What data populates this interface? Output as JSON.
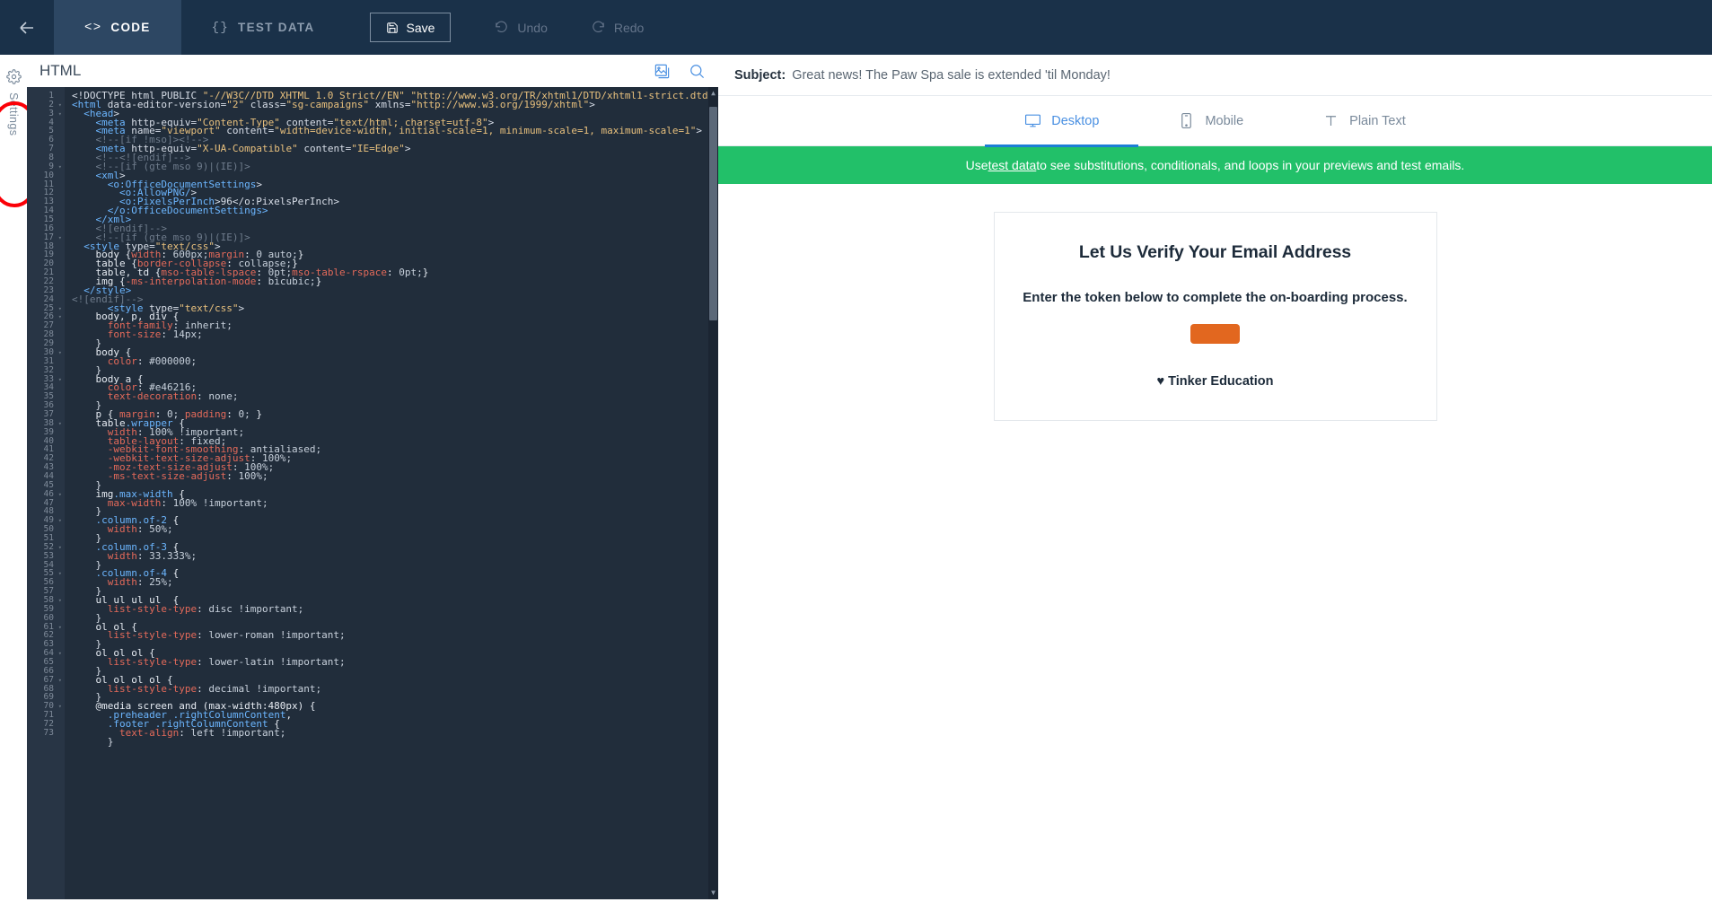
{
  "topbar": {
    "back_icon": "back-arrow-icon",
    "tabs": [
      {
        "id": "code",
        "glyph": "<>",
        "label": "CODE",
        "active": true
      },
      {
        "id": "test-data",
        "glyph": "{}",
        "label": "TEST DATA",
        "active": false
      }
    ],
    "save_label": "Save",
    "save_icon": "floppy-disk-icon",
    "undo_label": "Undo",
    "undo_icon": "undo-arrow-icon",
    "redo_label": "Redo",
    "redo_icon": "redo-arrow-icon"
  },
  "sidebar": {
    "settings_label": "Settings",
    "settings_icon": "gear-icon",
    "highlight_color": "#fb0007"
  },
  "editor": {
    "title": "HTML",
    "image_icon": "insert-image-icon",
    "search_icon": "search-icon",
    "first_line": 1,
    "last_line": 73,
    "fold_lines": [
      2,
      3,
      9,
      17,
      25,
      26,
      30,
      33,
      38,
      46,
      49,
      52,
      55,
      58,
      61,
      64,
      67,
      70
    ],
    "lines": [
      "<!DOCTYPE html PUBLIC \"-//W3C//DTD XHTML 1.0 Strict//EN\" \"http://www.w3.org/TR/xhtml1/DTD/xhtml1-strict.dtd\" >",
      "<html data-editor-version=\"2\" class=\"sg-campaigns\" xmlns=\"http://www.w3.org/1999/xhtml\">",
      "  <head>",
      "    <meta http-equiv=\"Content-Type\" content=\"text/html; charset=utf-8\">",
      "    <meta name=\"viewport\" content=\"width=device-width, initial-scale=1, minimum-scale=1, maximum-scale=1\">",
      "    <!--[if !mso]><!-->",
      "    <meta http-equiv=\"X-UA-Compatible\" content=\"IE=Edge\">",
      "    <!--<![endif]-->",
      "    <!--[if (gte mso 9)|(IE)]>",
      "    <xml>",
      "      <o:OfficeDocumentSettings>",
      "        <o:AllowPNG/>",
      "        <o:PixelsPerInch>96</o:PixelsPerInch>",
      "      </o:OfficeDocumentSettings>",
      "    </xml>",
      "    <![endif]-->",
      "    <!--[if (gte mso 9)|(IE)]>",
      "  <style type=\"text/css\">",
      "    body {width: 600px;margin: 0 auto;}",
      "    table {border-collapse: collapse;}",
      "    table, td {mso-table-lspace: 0pt;mso-table-rspace: 0pt;}",
      "    img {-ms-interpolation-mode: bicubic;}",
      "  </style>",
      "<![endif]-->",
      "      <style type=\"text/css\">",
      "    body, p, div {",
      "      font-family: inherit;",
      "      font-size: 14px;",
      "    }",
      "    body {",
      "      color: #000000;",
      "    }",
      "    body a {",
      "      color: #e46216;",
      "      text-decoration: none;",
      "    }",
      "    p { margin: 0; padding: 0; }",
      "    table.wrapper {",
      "      width:100% !important;",
      "      table-layout: fixed;",
      "      -webkit-font-smoothing: antialiased;",
      "      -webkit-text-size-adjust: 100%;",
      "      -moz-text-size-adjust: 100%;",
      "      -ms-text-size-adjust: 100%;",
      "    }",
      "    img.max-width {",
      "      max-width: 100% !important;",
      "    }",
      "    .column.of-2 {",
      "      width: 50%;",
      "    }",
      "    .column.of-3 {",
      "      width: 33.333%;",
      "    }",
      "    .column.of-4 {",
      "      width: 25%;",
      "    }",
      "    ul ul ul ul  {",
      "      list-style-type: disc !important;",
      "    }",
      "    ol ol {",
      "      list-style-type: lower-roman !important;",
      "    }",
      "    ol ol ol {",
      "      list-style-type: lower-latin !important;",
      "    }",
      "    ol ol ol ol {",
      "      list-style-type: decimal !important;",
      "    }",
      "    @media screen and (max-width:480px) {",
      "      .preheader .rightColumnContent,",
      "      .footer .rightColumnContent {",
      "        text-align: left !important;",
      "      }"
    ]
  },
  "preview": {
    "subject_label": "Subject:",
    "subject_value": "Great news! The Paw Spa sale is extended 'til Monday!",
    "device_tabs": [
      {
        "id": "desktop",
        "label": "Desktop",
        "icon": "monitor-icon",
        "active": true
      },
      {
        "id": "mobile",
        "label": "Mobile",
        "icon": "phone-icon",
        "active": false
      },
      {
        "id": "plain-text",
        "label": "Plain Text",
        "icon": "text-icon",
        "active": false
      }
    ],
    "banner": {
      "prefix": "Use ",
      "link": "test data",
      "suffix": " to see substitutions, conditionals, and loops in your previews and test emails.",
      "color": "#22c069"
    },
    "email": {
      "heading": "Let Us Verify Your Email Address",
      "subheading": "Enter the token below to complete the on-boarding process.",
      "cta_color": "#e2671f",
      "footer_heart": "♥",
      "footer_text": "Tinker Education"
    }
  }
}
